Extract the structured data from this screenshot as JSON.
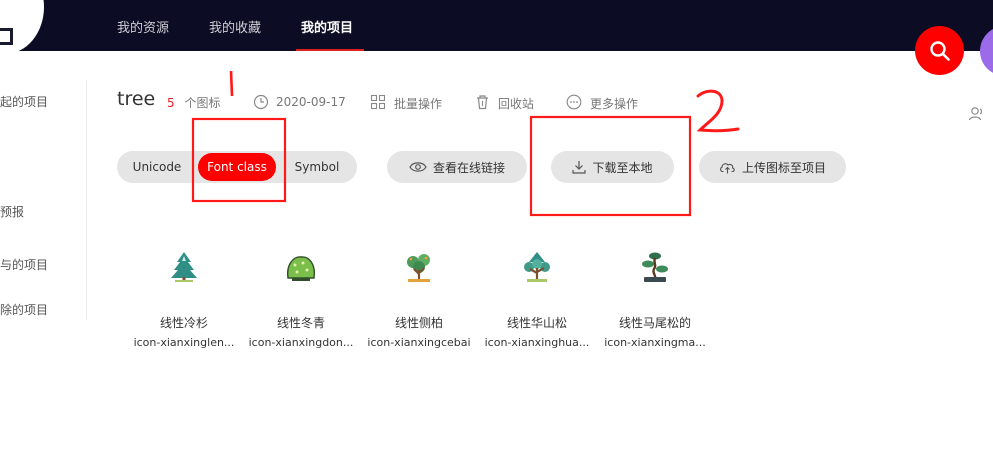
{
  "nav": {
    "tabs": [
      {
        "label": "我的资源"
      },
      {
        "label": "我的收藏"
      },
      {
        "label": "我的项目"
      }
    ]
  },
  "sidebar": {
    "items": [
      {
        "label": "起的项目"
      },
      {
        "label": "预报"
      },
      {
        "label": "与的项目"
      },
      {
        "label": "除的项目"
      }
    ]
  },
  "project": {
    "name": "tree",
    "icon_count": "5",
    "icon_unit": "个图标",
    "date": "2020-09-17",
    "batch_label": "批量操作",
    "recycle_label": "回收站",
    "more_label": "更多操作"
  },
  "formats": {
    "items": [
      {
        "label": "Unicode"
      },
      {
        "label": "Font class"
      },
      {
        "label": "Symbol"
      }
    ],
    "selected": "Font class"
  },
  "actions": {
    "view_link": "查看在线链接",
    "download": "下载至本地",
    "upload": "上传图标至项目"
  },
  "icons": [
    {
      "name": "线性冷杉",
      "code": "icon-xianxinglen..."
    },
    {
      "name": "线性冬青",
      "code": "icon-xianxingdon..."
    },
    {
      "name": "线性侧柏",
      "code": "icon-xianxingcebai"
    },
    {
      "name": "线性华山松",
      "code": "icon-xianxinghua..."
    },
    {
      "name": "线性马尾松的",
      "code": "icon-xianxingma..."
    }
  ],
  "annotations": {
    "mark_1": "1",
    "mark_2": "2"
  },
  "colors": {
    "topbar": "#0c0c24",
    "accent": "#ff0000",
    "avatar": "#9b6bea",
    "pill": "#e5e5e5"
  }
}
